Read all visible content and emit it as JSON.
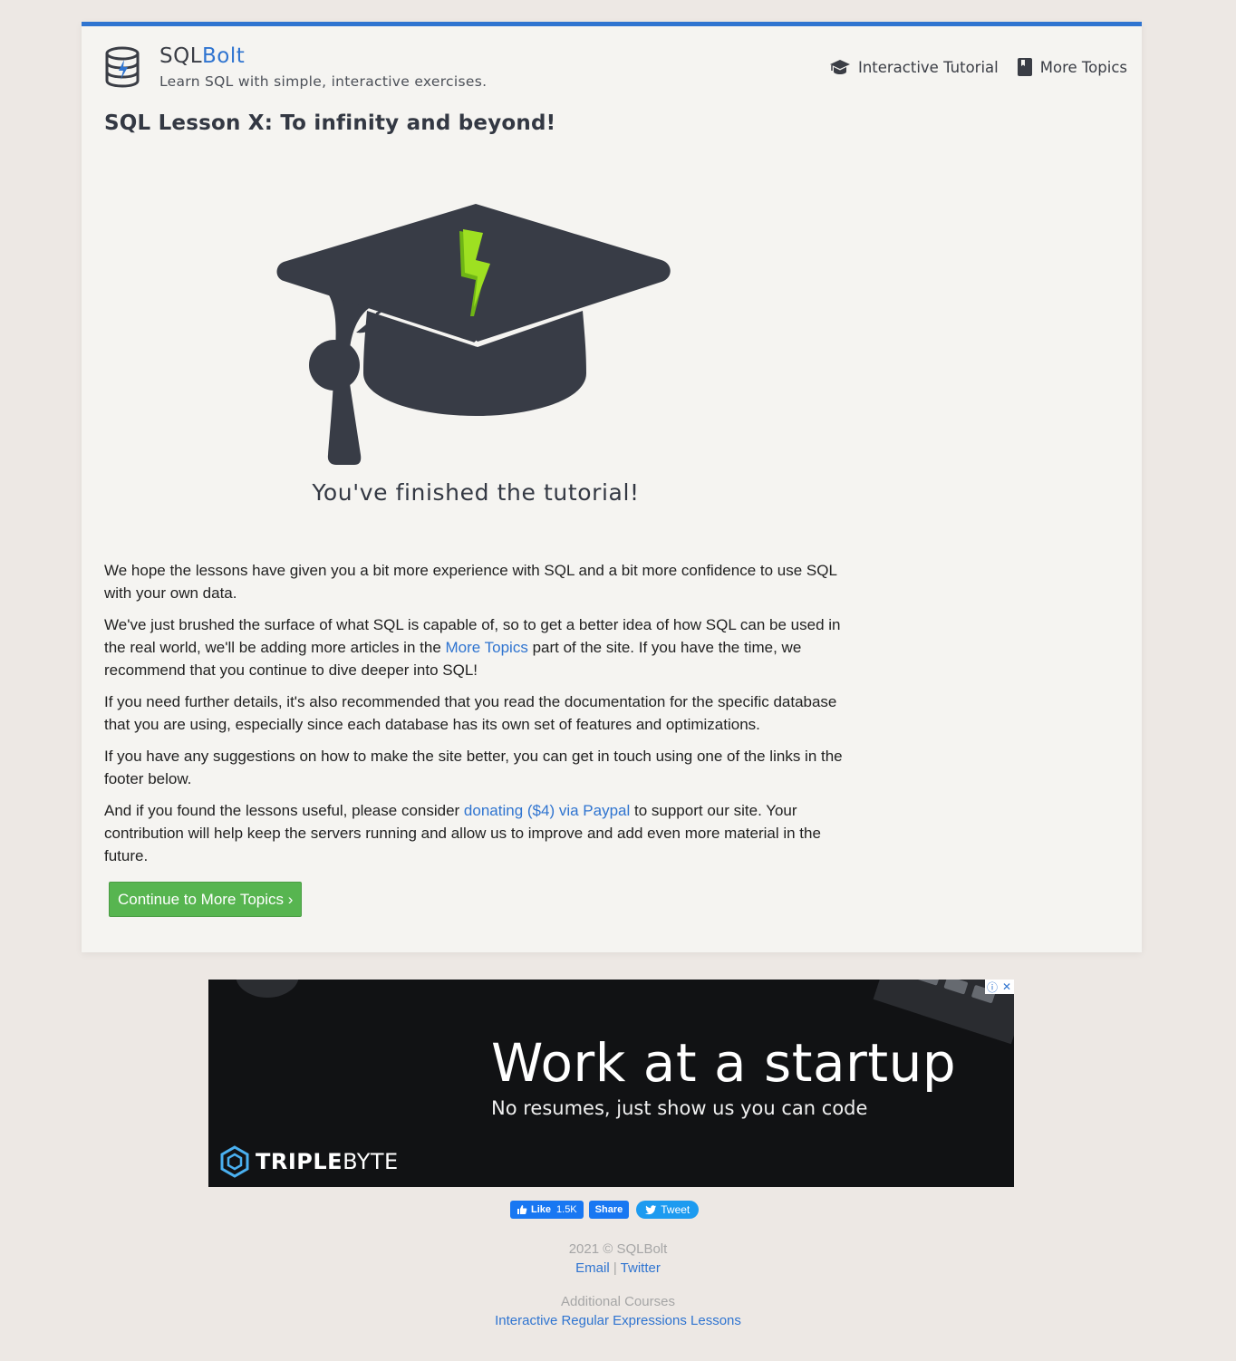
{
  "header": {
    "brand_sql": "SQL",
    "brand_bolt": "Bolt",
    "tagline": "Learn SQL with simple, interactive exercises.",
    "nav": [
      {
        "label": "Interactive Tutorial",
        "icon": "graduation-cap-icon"
      },
      {
        "label": "More Topics",
        "icon": "book-icon"
      }
    ]
  },
  "lesson": {
    "title": "SQL Lesson X: To infinity and beyond!",
    "finished_text": "You've finished the tutorial!",
    "p1": "We hope the lessons have given you a bit more experience with SQL and a bit more confidence to use SQL with your own data.",
    "p2_before": "We've just brushed the surface of what SQL is capable of, so to get a better idea of how SQL can be used in the real world, we'll be adding more articles in the ",
    "p2_link": "More Topics",
    "p2_after": " part of the site. If you have the time, we recommend that you continue to dive deeper into SQL!",
    "p3": "If you need further details, it's also recommended that you read the documentation for the specific database that you are using, especially since each database has its own set of features and optimizations.",
    "p4": "If you have any suggestions on how to make the site better, you can get in touch using one of the links in the footer below.",
    "p5_before": "And if you found the lessons useful, please consider ",
    "p5_link": "donating ($4) via Paypal",
    "p5_after": " to support our site. Your contribution will help keep the servers running and allow us to improve and add even more material in the future.",
    "continue_label": "Continue to More Topics ›"
  },
  "ad": {
    "headline": "Work at a startup",
    "subline": "No resumes, just show us you can code",
    "logo_bold": "TRIPLE",
    "logo_light": "BYTE",
    "info_glyph": "ⓘ",
    "close_glyph": "✕"
  },
  "social": {
    "like_label": "Like",
    "like_count": "1.5K",
    "share_label": "Share",
    "tweet_label": "Tweet"
  },
  "footer": {
    "copyright": "2021 © SQLBolt",
    "email": "Email",
    "separator": "|",
    "twitter": "Twitter",
    "additional": "Additional Courses",
    "regex_link": "Interactive Regular Expressions Lessons"
  },
  "colors": {
    "accent": "#2f74d0",
    "button_green": "#57b550",
    "bolt_green": "#8fd61f",
    "cap_dark": "#383c46"
  }
}
